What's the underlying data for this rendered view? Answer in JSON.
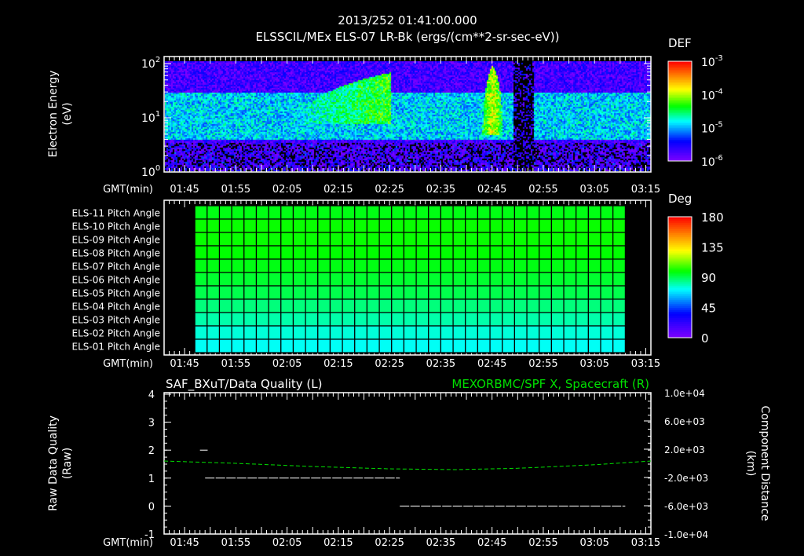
{
  "header": {
    "timestamp": "2013/252 01:41:00.000",
    "title": "ELSSCIL/MEx ELS-07 LR-Bk  (ergs/(cm**2-sr-sec-eV))"
  },
  "time_axis": {
    "label": "GMT(min)",
    "start": "01:41",
    "end": "03:16",
    "ticks": [
      "01:45",
      "01:55",
      "02:05",
      "02:15",
      "02:25",
      "02:35",
      "02:45",
      "02:55",
      "03:05",
      "03:15"
    ]
  },
  "colors": {
    "background": "#000000",
    "axis": "#ffffff",
    "green_trace": "#00e000"
  },
  "chart_data": [
    {
      "type": "heatmap",
      "name": "electron-spectrogram",
      "ylabel": "Electron Energy",
      "yunits": "(eV)",
      "yscale": "log",
      "ylim": [
        1,
        130
      ],
      "yticks": [
        "10^0",
        "10^1",
        "10^2"
      ],
      "colorbar": {
        "label": "DEF",
        "scale": "log",
        "range": [
          -6,
          -3
        ],
        "ticks": [
          "10^-6",
          "10^-5",
          "10^-4",
          "10^-3"
        ]
      },
      "features": [
        {
          "desc": "background band",
          "t_start": "01:41",
          "t_end": "03:16",
          "e_low": 4,
          "e_high": 30,
          "log_def": -4.9
        },
        {
          "desc": "enhancement",
          "t_start": "02:08",
          "t_end": "02:25",
          "e_low": 8,
          "e_high": 70,
          "log_def": -4.3
        },
        {
          "desc": "spike",
          "t_start": "02:43",
          "t_end": "02:47",
          "e_low": 5,
          "e_high": 100,
          "log_def": -3.9
        },
        {
          "desc": "gap",
          "t_start": "02:49",
          "t_end": "02:53",
          "e_low": 1,
          "e_high": 130,
          "log_def": -6.5
        }
      ]
    },
    {
      "type": "heatmap",
      "name": "pitch-angle",
      "rows": [
        "ELS-11 Pitch Angle",
        "ELS-10 Pitch Angle",
        "ELS-09 Pitch Angle",
        "ELS-08 Pitch Angle",
        "ELS-07 Pitch Angle",
        "ELS-06 Pitch Angle",
        "ELS-05 Pitch Angle",
        "ELS-04 Pitch Angle",
        "ELS-03 Pitch Angle",
        "ELS-02 Pitch Angle",
        "ELS-01 Pitch Angle"
      ],
      "values_deg": [
        97,
        100,
        100,
        99,
        97,
        94,
        91,
        86,
        81,
        76,
        73
      ],
      "t_start": "01:47",
      "t_end": "03:11",
      "columns": 35,
      "colorbar": {
        "label": "Deg",
        "range": [
          0,
          180
        ],
        "ticks": [
          "0",
          "45",
          "90",
          "135",
          "180"
        ]
      }
    },
    {
      "type": "line",
      "name": "data-quality",
      "title_left": "SAF_BXuT/Data Quality (L)",
      "title_right": "MEXORBMC/SPF X, Spacecraft (R)",
      "ylabel_left": "Raw Data Quality",
      "yunits_left": "(Raw)",
      "ylabel_right": "Component Distance",
      "yunits_right": "(km)",
      "ylim_left": [
        -1,
        4
      ],
      "yticks_left": [
        "4",
        "3",
        "2",
        "1",
        "0",
        "-1"
      ],
      "ylim_right": [
        -10000,
        10000
      ],
      "yticks_right": [
        "1.0e+04",
        "6.0e+03",
        "2.0e+03",
        "-2.0e+03",
        "-6.0e+03",
        "-1.0e+04"
      ],
      "quality_segments": [
        {
          "t_start": "01:48",
          "t_end": "01:49.5",
          "value": 2
        },
        {
          "t_start": "01:49",
          "t_end": "02:27",
          "value": 1
        },
        {
          "t_start": "02:27",
          "t_end": "03:11",
          "value": 0
        }
      ],
      "spf_x": {
        "t": [
          "01:41",
          "01:55",
          "02:10",
          "02:25",
          "02:38",
          "02:50",
          "03:05",
          "03:16"
        ],
        "km": [
          330,
          0,
          -450,
          -780,
          -890,
          -700,
          -200,
          330
        ]
      }
    }
  ]
}
